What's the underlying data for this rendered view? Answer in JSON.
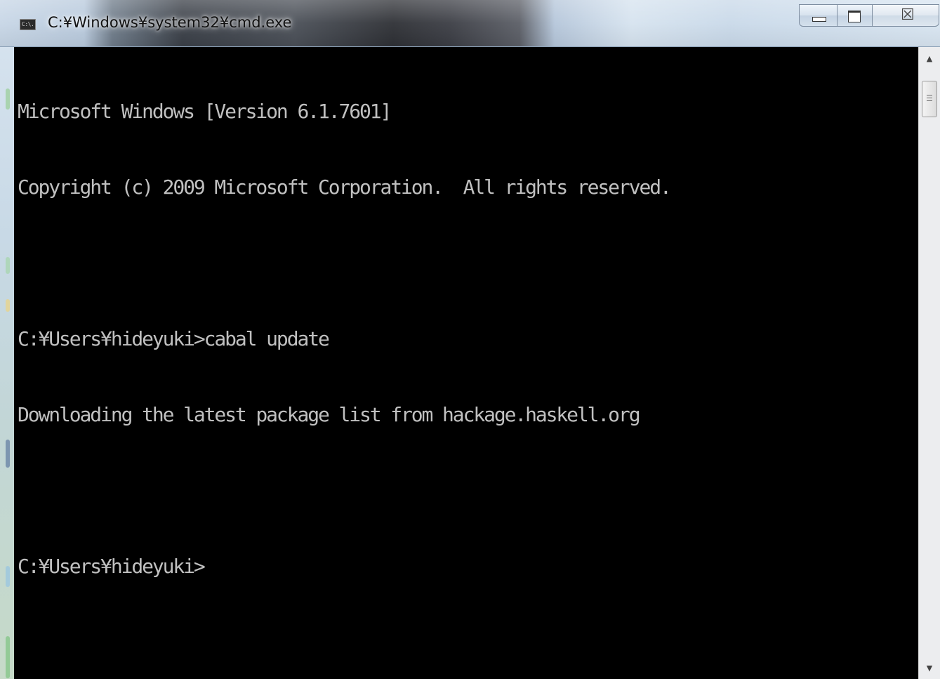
{
  "window": {
    "title": "C:¥Windows¥system32¥cmd.exe",
    "icon": "cmd-icon",
    "icon_text": "C:\\.",
    "controls": {
      "minimize": "minimize-icon",
      "maximize": "maximize-icon",
      "close": "close-icon",
      "close_glyph": "☒"
    }
  },
  "console": {
    "background": "#000000",
    "foreground": "#c0c0c0",
    "lines": [
      "Microsoft Windows [Version 6.1.7601]",
      "Copyright (c) 2009 Microsoft Corporation.  All rights reserved.",
      "",
      "C:¥Users¥hideyuki>cabal update",
      "Downloading the latest package list from hackage.haskell.org",
      "",
      "C:¥Users¥hideyuki>"
    ]
  },
  "scrollbar": {
    "up_arrow": "▲",
    "down_arrow": "▼"
  }
}
